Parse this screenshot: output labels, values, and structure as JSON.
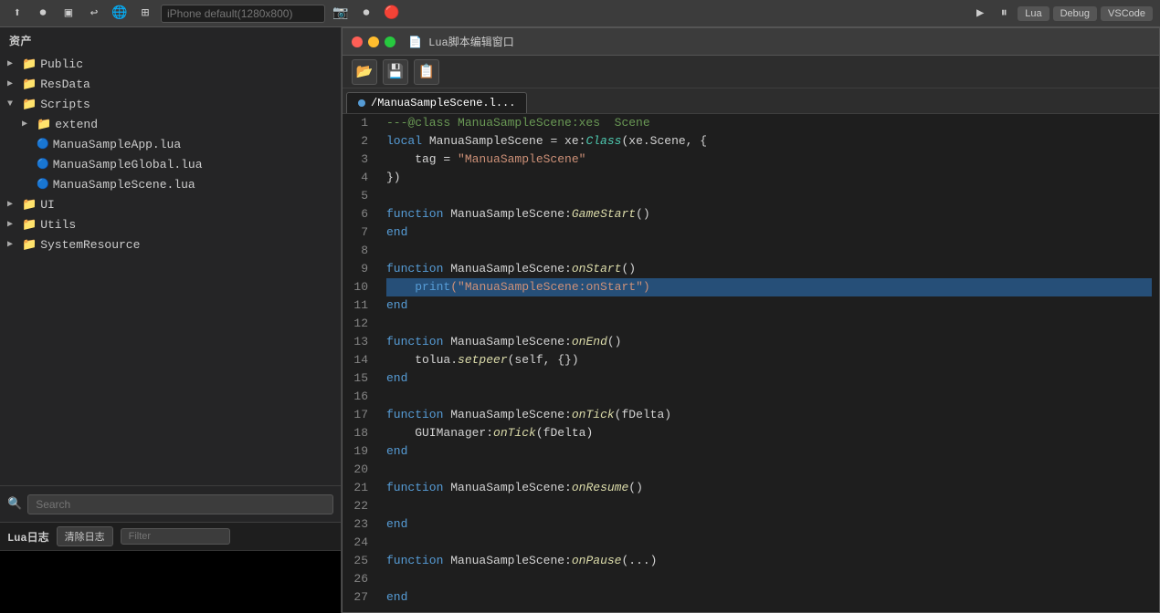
{
  "toolbar": {
    "device_placeholder": "iPhone default(1280x800)",
    "debug_label": "Debug",
    "lua_label": "Lua",
    "vscode_label": "VSCode"
  },
  "sidebar": {
    "title": "资产",
    "items": [
      {
        "id": "public",
        "label": "Public",
        "type": "folder",
        "indent": 0,
        "expanded": true
      },
      {
        "id": "resdata",
        "label": "ResData",
        "type": "folder",
        "indent": 0,
        "expanded": false
      },
      {
        "id": "scripts",
        "label": "Scripts",
        "type": "folder",
        "indent": 0,
        "expanded": true
      },
      {
        "id": "extend",
        "label": "extend",
        "type": "folder",
        "indent": 1,
        "expanded": false
      },
      {
        "id": "manualsampleapp",
        "label": "ManuaSampleApp.lua",
        "type": "file",
        "indent": 1
      },
      {
        "id": "manualsampleglobal",
        "label": "ManuaSampleGlobal.lua",
        "type": "file",
        "indent": 1
      },
      {
        "id": "manualsamplescene",
        "label": "ManuaSampleScene.lua",
        "type": "file",
        "indent": 1
      },
      {
        "id": "ui",
        "label": "UI",
        "type": "folder",
        "indent": 0,
        "expanded": false
      },
      {
        "id": "utils",
        "label": "Utils",
        "type": "folder",
        "indent": 0,
        "expanded": false
      },
      {
        "id": "systemresource",
        "label": "SystemResource",
        "type": "folder",
        "indent": 0,
        "expanded": false
      }
    ],
    "search_placeholder": "Search"
  },
  "lua_log": {
    "title": "Lua日志",
    "clear_btn": "清除日志",
    "filter_placeholder": "Filter"
  },
  "lua_editor": {
    "window_title": "Lua脚本编辑窗口",
    "tab_label": "/ManuaSampleScene.l...",
    "toolbar": {
      "open": "📂",
      "save": "💾",
      "saveas": "📄"
    },
    "lines": [
      {
        "num": 1,
        "tokens": [
          {
            "t": "comment",
            "v": "---@class ManuaSampleScene:xes  Scene"
          }
        ]
      },
      {
        "num": 2,
        "tokens": [
          {
            "t": "kw",
            "v": "local"
          },
          {
            "t": "plain",
            "v": " ManuaSampleScene = xe:"
          },
          {
            "t": "cls-italic",
            "v": "Class"
          },
          {
            "t": "plain",
            "v": "(xe.Scene, {"
          }
        ]
      },
      {
        "num": 3,
        "tokens": [
          {
            "t": "plain",
            "v": "    tag = "
          },
          {
            "t": "string",
            "v": "\"ManuaSampleScene\""
          }
        ]
      },
      {
        "num": 4,
        "tokens": [
          {
            "t": "plain",
            "v": "})"
          }
        ]
      },
      {
        "num": 5,
        "tokens": []
      },
      {
        "num": 6,
        "tokens": [
          {
            "t": "kw",
            "v": "function"
          },
          {
            "t": "plain",
            "v": " ManuaSampleScene:"
          },
          {
            "t": "method",
            "v": "GameStart"
          },
          {
            "t": "plain",
            "v": "()"
          }
        ]
      },
      {
        "num": 7,
        "tokens": [
          {
            "t": "kw",
            "v": "end"
          }
        ]
      },
      {
        "num": 8,
        "tokens": []
      },
      {
        "num": 9,
        "tokens": [
          {
            "t": "kw",
            "v": "function"
          },
          {
            "t": "plain",
            "v": " ManuaSampleScene:"
          },
          {
            "t": "method",
            "v": "onStart"
          },
          {
            "t": "plain",
            "v": "()"
          }
        ]
      },
      {
        "num": 10,
        "tokens": [
          {
            "t": "plain",
            "v": "    "
          },
          {
            "t": "kw",
            "v": "print"
          },
          {
            "t": "string",
            "v": "(\"ManuaSampleScene:onStart\")"
          }
        ],
        "highlighted": true
      },
      {
        "num": 11,
        "tokens": [
          {
            "t": "kw",
            "v": "end"
          }
        ]
      },
      {
        "num": 12,
        "tokens": []
      },
      {
        "num": 13,
        "tokens": [
          {
            "t": "kw",
            "v": "function"
          },
          {
            "t": "plain",
            "v": " ManuaSampleScene:"
          },
          {
            "t": "method",
            "v": "onEnd"
          },
          {
            "t": "plain",
            "v": "()"
          }
        ]
      },
      {
        "num": 14,
        "tokens": [
          {
            "t": "plain",
            "v": "    tolua."
          },
          {
            "t": "method",
            "v": "setpeer"
          },
          {
            "t": "plain",
            "v": "(self, {})"
          }
        ]
      },
      {
        "num": 15,
        "tokens": [
          {
            "t": "kw",
            "v": "end"
          }
        ]
      },
      {
        "num": 16,
        "tokens": []
      },
      {
        "num": 17,
        "tokens": [
          {
            "t": "kw",
            "v": "function"
          },
          {
            "t": "plain",
            "v": " ManuaSampleScene:"
          },
          {
            "t": "method",
            "v": "onTick"
          },
          {
            "t": "plain",
            "v": "(fDelta)"
          }
        ]
      },
      {
        "num": 18,
        "tokens": [
          {
            "t": "plain",
            "v": "    GUIManager:"
          },
          {
            "t": "method",
            "v": "onTick"
          },
          {
            "t": "plain",
            "v": "(fDelta)"
          }
        ]
      },
      {
        "num": 19,
        "tokens": [
          {
            "t": "kw",
            "v": "end"
          }
        ]
      },
      {
        "num": 20,
        "tokens": []
      },
      {
        "num": 21,
        "tokens": [
          {
            "t": "kw",
            "v": "function"
          },
          {
            "t": "plain",
            "v": " ManuaSampleScene:"
          },
          {
            "t": "method",
            "v": "onResume"
          },
          {
            "t": "plain",
            "v": "()"
          }
        ]
      },
      {
        "num": 22,
        "tokens": []
      },
      {
        "num": 23,
        "tokens": [
          {
            "t": "kw",
            "v": "end"
          }
        ]
      },
      {
        "num": 24,
        "tokens": []
      },
      {
        "num": 25,
        "tokens": [
          {
            "t": "kw",
            "v": "function"
          },
          {
            "t": "plain",
            "v": " ManuaSampleScene:"
          },
          {
            "t": "method",
            "v": "onPause"
          },
          {
            "t": "plain",
            "v": "(...)"
          }
        ]
      },
      {
        "num": 26,
        "tokens": []
      },
      {
        "num": 27,
        "tokens": [
          {
            "t": "kw",
            "v": "end"
          }
        ]
      }
    ]
  }
}
